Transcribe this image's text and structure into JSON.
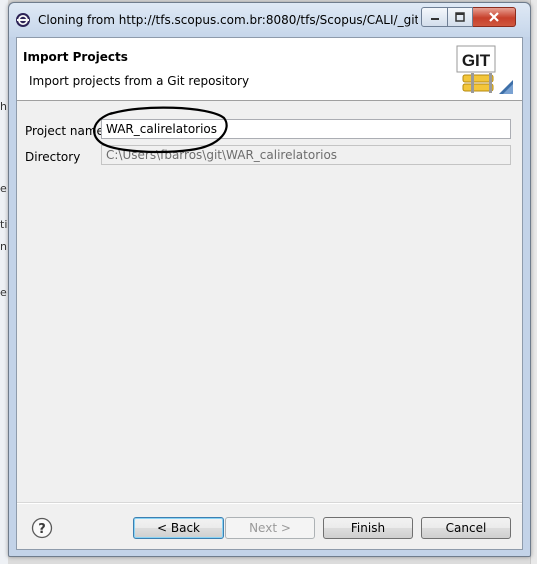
{
  "window": {
    "title": "Cloning from http://tfs.scopus.com.br:8080/tfs/Scopus/CALI/_git/WAR..."
  },
  "header": {
    "title": "Import Projects",
    "description": "Import projects from a Git repository",
    "logo_text": "GIT"
  },
  "form": {
    "project_name_label": "Project name",
    "project_name_value": "WAR_calirelatorios",
    "directory_label": "Directory",
    "directory_value": "C:\\Users\\fbarros\\git\\WAR_calirelatorios"
  },
  "buttons": {
    "back": "< Back",
    "next": "Next >",
    "finish": "Finish",
    "cancel": "Cancel"
  },
  "icons": {
    "app": "eclipse-icon",
    "help": "help-icon",
    "minimize": "minimize-icon",
    "maximize": "maximize-icon",
    "close": "close-icon"
  }
}
